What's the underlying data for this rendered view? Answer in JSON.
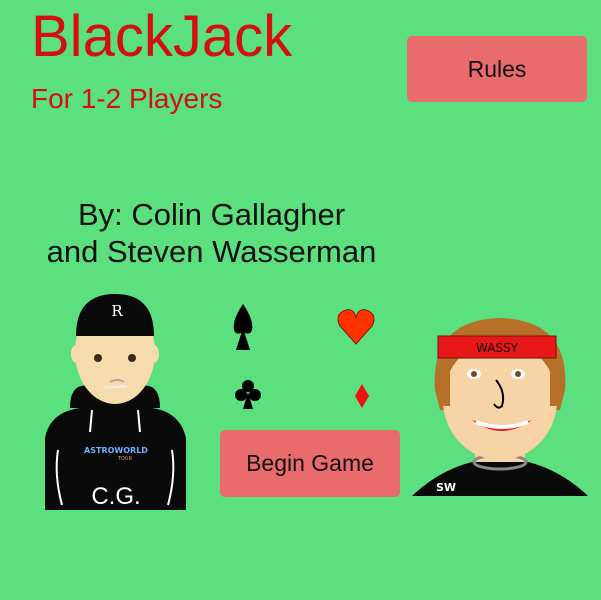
{
  "title": "BlackJack",
  "subtitle": "For 1-2 Players",
  "authors": {
    "line1": "By: Colin Gallagher",
    "line2": "and Steven Wasserman"
  },
  "buttons": {
    "rules": "Rules",
    "begin": "Begin Game"
  },
  "suits": [
    "spade-icon",
    "heart-icon",
    "club-icon",
    "diamond-icon"
  ],
  "avatars": {
    "left": {
      "cap_logo": "R",
      "shirt_text": "ASTROWORLD",
      "shirt_subtext": "TOUR",
      "initials": "C.G."
    },
    "right": {
      "headband_text": "WASSY",
      "initials": "SW"
    }
  },
  "colors": {
    "background": "#5cdf7e",
    "title": "#d40f0f",
    "button": "#e96b6c",
    "headband": "#e81818"
  }
}
